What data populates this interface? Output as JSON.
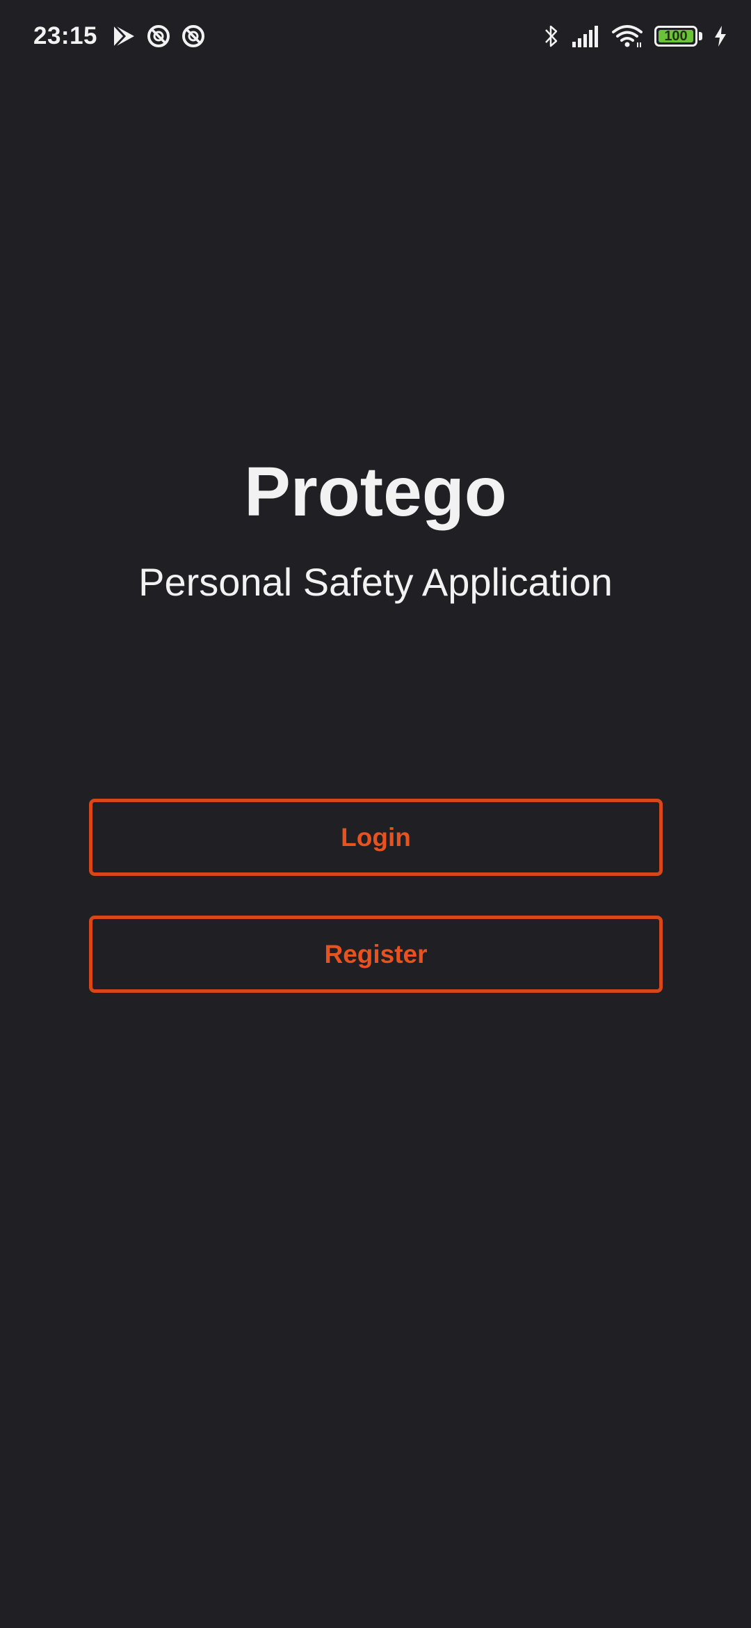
{
  "status_bar": {
    "time": "23:15",
    "left_icons": [
      "play-store-icon",
      "vpn-circle-icon",
      "vpn-circle-icon"
    ],
    "right_icons": [
      "bluetooth-icon",
      "cellular-signal-icon",
      "wifi-icon",
      "battery-icon",
      "charging-bolt-icon"
    ],
    "battery_level": "100",
    "battery_color": "#6cc33a"
  },
  "app": {
    "title": "Protego",
    "subtitle": "Personal Safety Application"
  },
  "actions": {
    "login_label": "Login",
    "register_label": "Register"
  },
  "colors": {
    "background": "#202024",
    "accent": "#d8471a",
    "text": "#f2f2f2"
  }
}
